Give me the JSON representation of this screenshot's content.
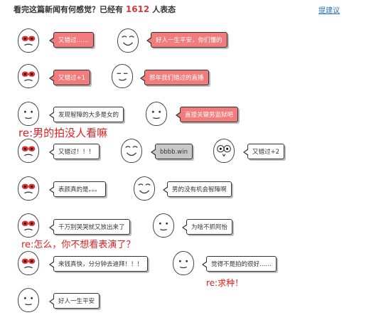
{
  "header": {
    "title_prefix": "看完这篇新闻有何感觉？已经有",
    "count": "1612",
    "title_suffix": "人表态",
    "suggest_link": "提建议"
  },
  "reactions": [
    {
      "text": "又错过……",
      "style": "red"
    },
    {
      "text": "好人一生平安，你们懂的",
      "style": "red"
    },
    {
      "text": "又错过+1",
      "style": "red"
    },
    {
      "text": "那年我们错过的直播",
      "style": "red"
    },
    {
      "text": "发现智障的大多是女的",
      "style": "white"
    },
    {
      "text": "直接关键男监狱吧",
      "style": "red"
    },
    {
      "text": "又错过！！！",
      "style": "white"
    },
    {
      "text": "bbbb.win",
      "style": "gray"
    },
    {
      "text": "又错过+2",
      "style": "white"
    },
    {
      "text": "表颜真的是。。。",
      "style": "white"
    },
    {
      "text": "男的没有机会智障啊",
      "style": "white"
    },
    {
      "text": "千万别哭哭就又放出来了",
      "style": "white"
    },
    {
      "text": "为啥不抓阿怡",
      "style": "white"
    },
    {
      "text": "来钱真快，分分钟去迪拜！！！",
      "style": "white"
    },
    {
      "text": "觉得不是拍的很好……",
      "style": "white"
    },
    {
      "text": "好人一生平安",
      "style": "white"
    }
  ],
  "handwritten_notes": [
    "re:男的拍没人看嘛",
    "re:怎么，你不想看表演了？",
    "re:求种！"
  ]
}
